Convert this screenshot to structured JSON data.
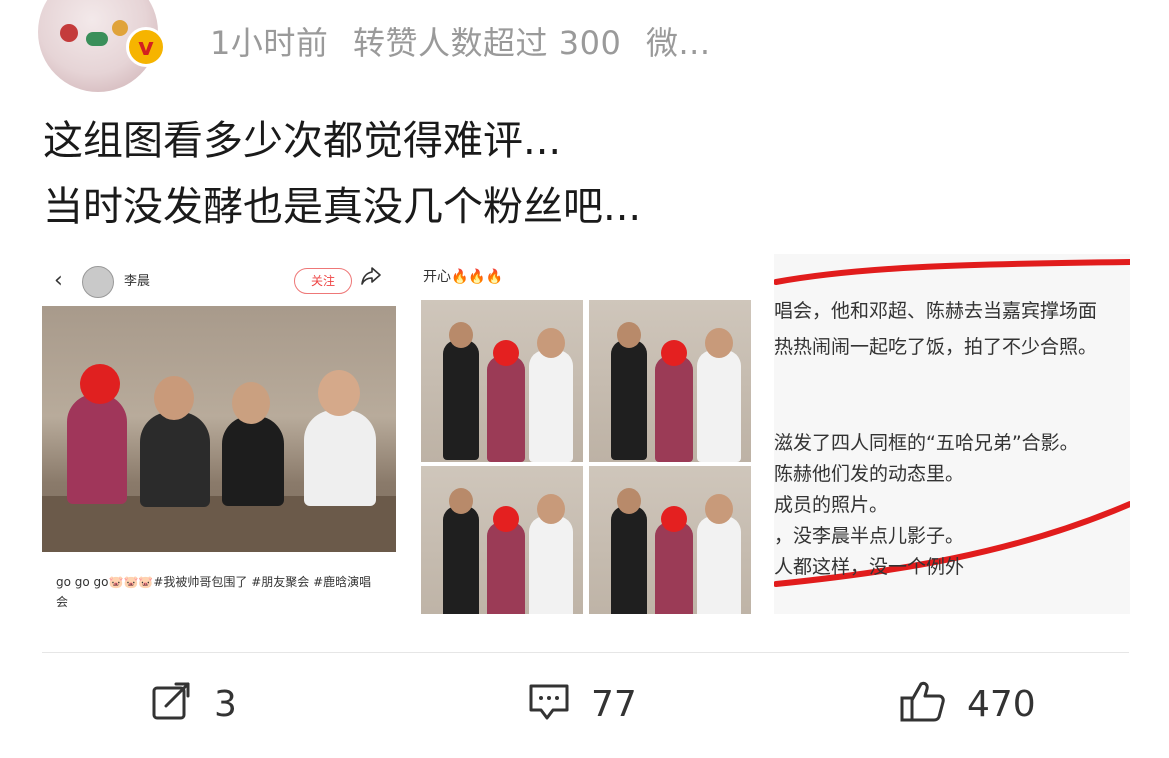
{
  "post": {
    "meta": {
      "time": "1小时前",
      "reposts_info": "转赞人数超过 300",
      "source": "微..."
    },
    "text": [
      "这组图看多少次都觉得难评...",
      "当时没发酵也是真没几个粉丝吧..."
    ]
  },
  "images": {
    "img1": {
      "back": "‹",
      "username": "李晨",
      "follow": "关注",
      "caption": "go go go🐷🐷🐷#我被帅哥包围了 #朋友聚会 #鹿晗演唱会"
    },
    "img2": {
      "caption": "开心🔥🔥🔥"
    },
    "img3": {
      "lines": [
        "唱会，他和邓超、陈赫去当嘉宾撑场面",
        "热热闹闹一起吃了饭，拍了不少合照。",
        "",
        "滋发了四人同框的“五哈兄弟”合影。",
        "陈赫他们发的动态里。",
        "成员的照片。",
        "，没李晨半点儿影子。",
        "人都这样，没一个例外"
      ]
    }
  },
  "actions": {
    "repost": {
      "count": "3",
      "icon": "repost-icon"
    },
    "comment": {
      "count": "77",
      "icon": "comment-icon"
    },
    "like": {
      "count": "470",
      "icon": "thumbs-up-icon"
    }
  },
  "colors": {
    "meta": "#9a9a9a",
    "text": "#1a1a1a",
    "verified_badge": "#f6b400",
    "red_marker": "#e11c1c"
  }
}
